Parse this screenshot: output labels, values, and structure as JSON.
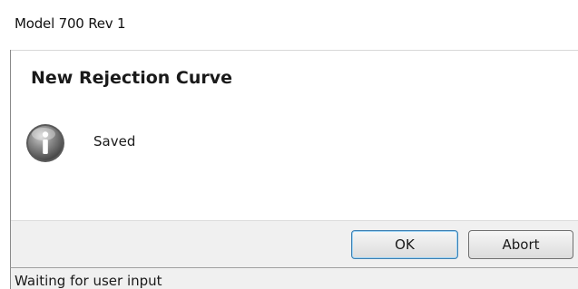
{
  "window": {
    "title": "Model 700 Rev 1"
  },
  "dialog": {
    "heading": "New Rejection Curve",
    "icon": "info-icon",
    "message": "Saved",
    "buttons": {
      "ok_label": "OK",
      "abort_label": "Abort"
    }
  },
  "status_bar": {
    "text": "Waiting for user input"
  },
  "colors": {
    "default_button_border": "#3c7fb1",
    "button_bar_background": "#f0f0f0"
  }
}
